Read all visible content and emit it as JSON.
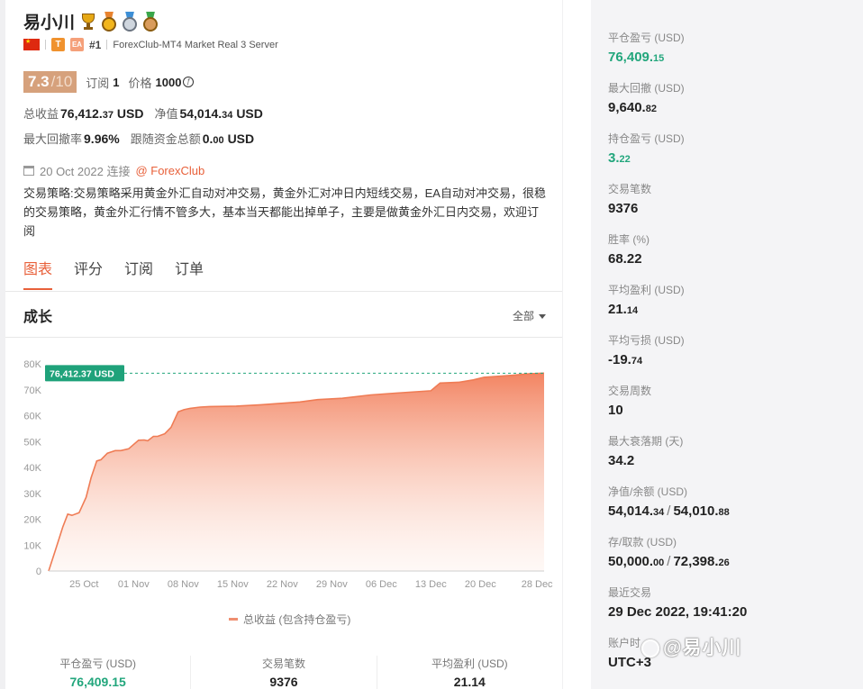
{
  "trader": {
    "name": "易小川",
    "rank": "#1",
    "server": "ForexClub-MT4 Market Real 3 Server",
    "tag_t": "T",
    "tag_ea": "EA",
    "score": "7.3",
    "score_den": "/10",
    "subscribe_label": "订阅",
    "subscribe_count": "1",
    "price_label": "价格",
    "price_value": "1000",
    "price_icon": "ƒ"
  },
  "stats": {
    "total_profit_label": "总收益",
    "total_profit_value": "76,412.",
    "total_profit_decimal": "37",
    "total_profit_unit": "USD",
    "equity_label": "净值",
    "equity_value": "54,014.",
    "equity_decimal": "34",
    "equity_unit": "USD",
    "max_dd_label": "最大回撤率",
    "max_dd_value": "9.96%",
    "follow_label": "跟随资金总额",
    "follow_value": "0.",
    "follow_decimal": "00",
    "follow_unit": "USD"
  },
  "connection": {
    "date_text": "20 Oct 2022 连接",
    "broker_link": "@ ForexClub"
  },
  "strategy_text": "交易策略:交易策略采用黄金外汇自动对冲交易，黄金外汇对冲日内短线交易，EA自动对冲交易，很稳的交易策略，黄金外汇行情不管多大，基本当天都能出掉单子，主要是做黄金外汇日内交易，欢迎订阅",
  "tabs": [
    "图表",
    "评分",
    "订阅",
    "订单"
  ],
  "growth": {
    "title": "成长",
    "range_label": "全部",
    "current_label": "76,412.37 USD",
    "legend": "总收益 (包含持仓盈亏)"
  },
  "chart_data": {
    "type": "area",
    "title": "",
    "xlabel": "",
    "ylabel": "",
    "ylim": [
      0,
      80000
    ],
    "yticks": [
      0,
      10000,
      20000,
      30000,
      40000,
      50000,
      60000,
      70000,
      80000
    ],
    "ytick_labels": [
      "0",
      "10K",
      "20K",
      "30K",
      "40K",
      "50K",
      "60K",
      "70K",
      "80K"
    ],
    "xtick_labels": [
      "25 Oct",
      "01 Nov",
      "08 Nov",
      "15 Nov",
      "22 Nov",
      "29 Nov",
      "06 Dec",
      "13 Dec",
      "20 Dec",
      "28 Dec"
    ],
    "xtick_days": [
      5,
      12,
      19,
      26,
      33,
      40,
      47,
      54,
      61,
      69
    ],
    "x_range_days": [
      0,
      70
    ],
    "series": [
      {
        "name": "总收益 (包含持仓盈亏)",
        "x_days": [
          0,
          1,
          2,
          2.7,
          3.3,
          4.3,
          5.3,
          6,
          6.8,
          7.4,
          8.3,
          9.4,
          10.2,
          11.3,
          12.7,
          13.5,
          14,
          14.8,
          15.4,
          16.4,
          17.3,
          18.3,
          19.1,
          20,
          21.4,
          22.7,
          26.5,
          30,
          35.5,
          38,
          41.5,
          45.5,
          49,
          54,
          55.3,
          58,
          60,
          61.5,
          65.5,
          67.5,
          70
        ],
        "values": [
          0,
          8500,
          17000,
          22000,
          21500,
          22500,
          28500,
          36000,
          42500,
          43000,
          45500,
          46500,
          46500,
          47200,
          50500,
          50600,
          50300,
          52000,
          52000,
          53000,
          55500,
          61500,
          62300,
          62800,
          63300,
          63500,
          63700,
          64200,
          65300,
          66200,
          66700,
          68000,
          68700,
          69600,
          72600,
          72900,
          73800,
          74800,
          75600,
          76100,
          76412
        ]
      }
    ],
    "annotation": "76,412.37 USD",
    "grid": false,
    "colors": {
      "line": "#ef7c55",
      "fill_top": "#f27e5a",
      "marker_line": "#22a67c"
    }
  },
  "bottom_stats": [
    {
      "label": "平仓盈亏 (USD)",
      "value": "76,409.15"
    },
    {
      "label": "交易笔数",
      "value": "9376"
    },
    {
      "label": "平均盈利 (USD)",
      "value": "21.14"
    }
  ],
  "sidebar": {
    "closed_pnl": {
      "label": "平仓盈亏 (USD)",
      "int": "76,409.",
      "dec": "15"
    },
    "max_drawdown": {
      "label": "最大回撤 (USD)",
      "int": "9,640.",
      "dec": "82"
    },
    "open_pnl": {
      "label": "持仓盈亏 (USD)",
      "int": "3.",
      "dec": "22"
    },
    "trades": {
      "label": "交易笔数",
      "value": "9376"
    },
    "win_rate": {
      "label": "胜率 (%)",
      "value": "68.22"
    },
    "avg_profit": {
      "label": "平均盈利 (USD)",
      "int": "21.",
      "dec": "14"
    },
    "avg_loss": {
      "label": "平均亏损 (USD)",
      "int": "-19.",
      "dec": "74"
    },
    "trade_weeks": {
      "label": "交易周数",
      "value": "10"
    },
    "max_decay": {
      "label": "最大衰落期 (天)",
      "value": "34.2"
    },
    "equity_balance": {
      "label": "净值/余额 (USD)",
      "a_int": "54,014.",
      "a_dec": "34",
      "b_int": "54,010.",
      "b_dec": "88"
    },
    "deposit_withdraw": {
      "label": "存/取款 (USD)",
      "a_int": "50,000.",
      "a_dec": "00",
      "b_int": "72,398.",
      "b_dec": "26"
    },
    "last_trade": {
      "label": "最近交易",
      "value": "29 Dec 2022, 19:41:20"
    },
    "timezone": {
      "label": "账户时",
      "value": "UTC+3"
    }
  },
  "watermark": "@易小川"
}
